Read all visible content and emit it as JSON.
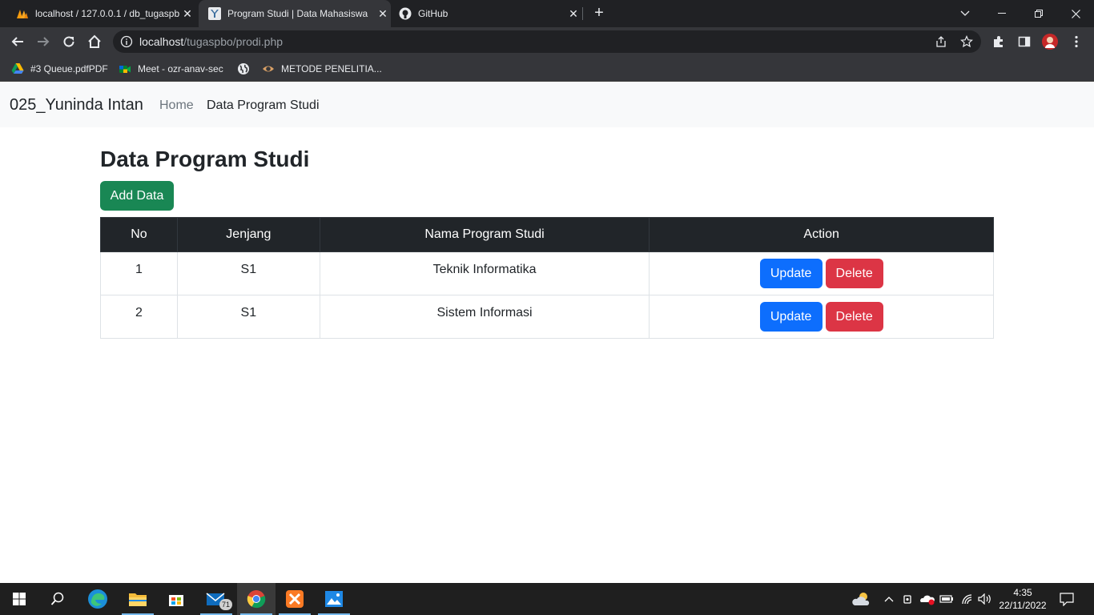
{
  "browser": {
    "tabs": [
      {
        "title": "localhost / 127.0.0.1 / db_tugaspbo",
        "icon": "phpmyadmin-icon",
        "active": false
      },
      {
        "title": "Program Studi | Data Mahasiswa",
        "icon": "yii-icon",
        "active": true
      },
      {
        "title": "GitHub",
        "icon": "github-icon",
        "active": false
      }
    ],
    "new_tab_label": "+",
    "address": {
      "host": "localhost",
      "path": "/tugaspbo/prodi.php"
    },
    "bookmarks": [
      {
        "label": "#3 Queue.pdfPDF",
        "icon": "google-drive-icon"
      },
      {
        "label": "Meet - ozr-anav-sec",
        "icon": "google-meet-icon"
      },
      {
        "label": "",
        "icon": "globe-icon"
      },
      {
        "label": "METODE PENELITIA...",
        "icon": "eye-icon"
      }
    ]
  },
  "navbar": {
    "brand": "025_Yuninda Intan",
    "links": [
      "Home",
      "Data Program Studi"
    ]
  },
  "main": {
    "title": "Data Program Studi",
    "add_button": "Add Data",
    "table": {
      "headers": [
        "No",
        "Jenjang",
        "Nama Program Studi",
        "Action"
      ],
      "rows": [
        {
          "no": "1",
          "jenjang": "S1",
          "nama": "Teknik Informatika"
        },
        {
          "no": "2",
          "jenjang": "S1",
          "nama": "Sistem Informasi"
        }
      ],
      "update_label": "Update",
      "delete_label": "Delete"
    }
  },
  "taskbar": {
    "mail_badge": "71",
    "time": "4:35",
    "date": "22/11/2022"
  },
  "colors": {
    "success": "#198754",
    "primary": "#0d6efd",
    "danger": "#dc3545",
    "dark": "#212529"
  }
}
